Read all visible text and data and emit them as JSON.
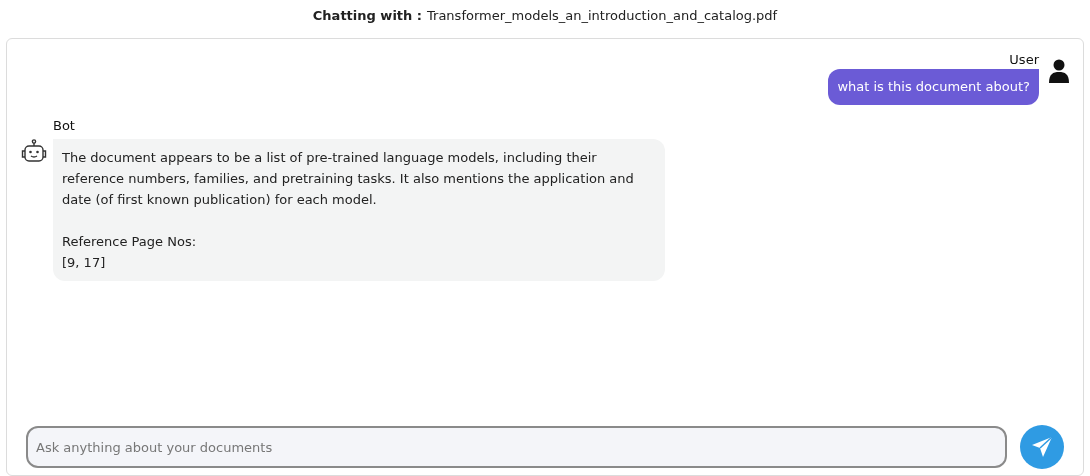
{
  "header": {
    "label": "Chatting with :",
    "filename": "Transformer_models_an_introduction_and_catalog.pdf"
  },
  "messages": [
    {
      "kind": "user",
      "sender": "User",
      "paragraphs": [
        "what is this document about?"
      ]
    },
    {
      "kind": "bot",
      "sender": "Bot",
      "paragraphs": [
        "The document appears to be a list of pre-trained language models, including their reference numbers, families, and pretraining tasks. It also mentions the application and date (of first known publication) for each model.",
        "Reference Page Nos:\n[9, 17]"
      ]
    }
  ],
  "composer": {
    "placeholder": "Ask anything about your documents"
  }
}
